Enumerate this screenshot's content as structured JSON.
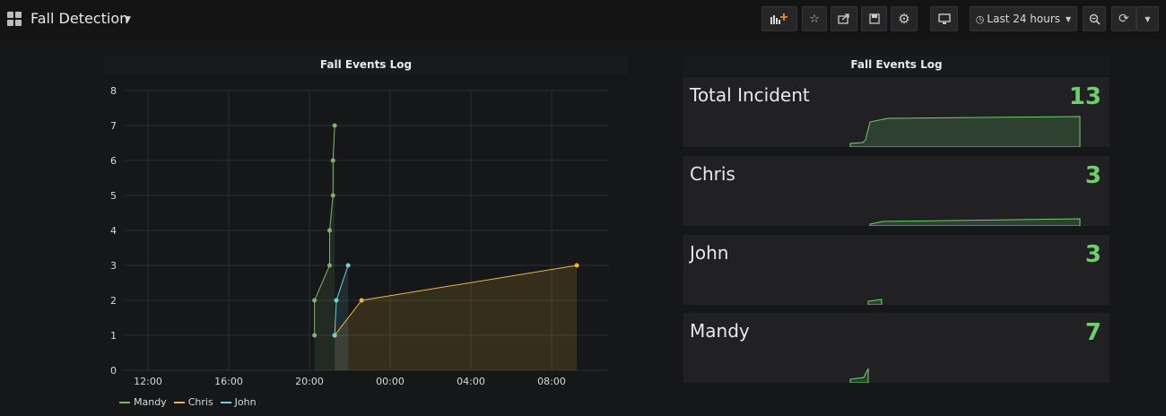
{
  "dashboard": {
    "title": "Fall Detection"
  },
  "toolbar": {
    "time_range": "Last 24 hours",
    "buttons": [
      "add-panel",
      "star",
      "share",
      "save",
      "settings",
      "cycle-view",
      "time-range",
      "zoom-out",
      "refresh",
      "refresh-interval"
    ]
  },
  "graph_panel": {
    "title": "Fall Events Log",
    "chart_data": {
      "type": "line",
      "x_ticks": [
        "12:00",
        "16:00",
        "20:00",
        "00:00",
        "04:00",
        "08:00"
      ],
      "y_ticks": [
        "0",
        "1",
        "2",
        "3",
        "4",
        "5",
        "6",
        "7",
        "8"
      ],
      "ylim": [
        0,
        8
      ],
      "grid": true,
      "legend_position": "bottom-left",
      "series": [
        {
          "name": "Mandy",
          "color": "#7eb26d",
          "x": [
            "20:15",
            "20:15",
            "21:00",
            "21:00",
            "21:10",
            "21:10",
            "21:15"
          ],
          "values": [
            1,
            2,
            3,
            4,
            5,
            6,
            7
          ]
        },
        {
          "name": "Chris",
          "color": "#eab839",
          "x": [
            "21:15",
            "22:35",
            "09:15"
          ],
          "values": [
            1,
            2,
            3
          ]
        },
        {
          "name": "John",
          "color": "#6ed0e0",
          "x": [
            "21:15",
            "21:20",
            "21:55"
          ],
          "values": [
            1,
            2,
            3
          ]
        }
      ]
    }
  },
  "stats_panel": {
    "title": "Fall Events Log",
    "stats": [
      {
        "name": "Total Incident",
        "value": "13"
      },
      {
        "name": "Chris",
        "value": "3"
      },
      {
        "name": "John",
        "value": "3"
      },
      {
        "name": "Mandy",
        "value": "7"
      }
    ],
    "value_color": "#6ccf6c",
    "spark_color": "#6ccf6c"
  }
}
